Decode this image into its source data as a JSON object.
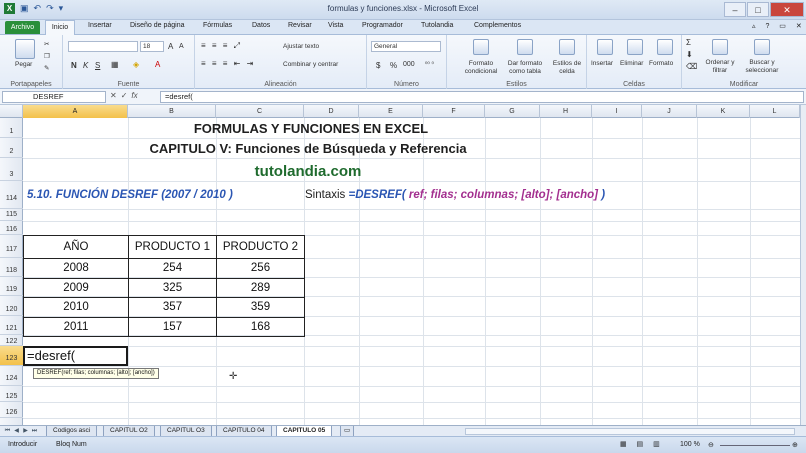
{
  "window": {
    "title": "formulas y funciones.xlsx - Microsoft Excel",
    "buttons": [
      "–",
      "□",
      "✕"
    ]
  },
  "ribbon_tabs": {
    "file": "Archivo",
    "active": "Inicio",
    "items": [
      "Insertar",
      "Diseño de página",
      "Fórmulas",
      "Datos",
      "Revisar",
      "Vista",
      "Programador",
      "Tutolandia",
      "Complementos"
    ]
  },
  "ribbon": {
    "groups": [
      "Portapapeles",
      "Fuente",
      "Alineación",
      "Número",
      "Estilos",
      "Celdas",
      "Modificar"
    ],
    "paste_label": "Pegar",
    "font_size": "18",
    "bold": "N",
    "italic": "K",
    "underline": "S",
    "wrap_text": "Ajustar texto",
    "merge_center": "Combinar y centrar",
    "number_format": "General",
    "currency": "$",
    "percent": "%",
    "thousands": "000",
    "styles_buttons": [
      "Formato condicional",
      "Dar formato como tabla",
      "Estilos de celda"
    ],
    "cells_buttons": [
      "Insertar",
      "Eliminar",
      "Formato"
    ],
    "edit_buttons": [
      "Ordenar y filtrar",
      "Buscar y seleccionar"
    ]
  },
  "formula_bar": {
    "name_box": "DESREF",
    "fx": "fx",
    "value": "=desref("
  },
  "columns": [
    "A",
    "B",
    "C",
    "D",
    "E",
    "F",
    "G",
    "H",
    "I",
    "J",
    "K",
    "L"
  ],
  "rows": [
    "1",
    "2",
    "3",
    "114",
    "115",
    "116",
    "117",
    "118",
    "119",
    "120",
    "121",
    "122",
    "123",
    "124",
    "125",
    "126"
  ],
  "sheet": {
    "title1": "FORMULAS Y FUNCIONES EN EXCEL",
    "title2": "CAPITULO V: Funciones de Búsqueda y Referencia",
    "site": "tutolandia.com",
    "section": "5.10. FUNCIÓN DESREF (2007 / 2010 )",
    "syntax_label": "Sintaxis",
    "syntax_fn": "=DESREF(",
    "syntax_args": "ref; filas; columnas; [alto]; [ancho]",
    "syntax_close": " )",
    "table": {
      "headers": [
        "AÑO",
        "PRODUCTO 1",
        "PRODUCTO 2"
      ],
      "rows": [
        [
          "2008",
          "254",
          "256"
        ],
        [
          "2009",
          "325",
          "289"
        ],
        [
          "2010",
          "357",
          "359"
        ],
        [
          "2011",
          "157",
          "168"
        ]
      ]
    },
    "active_cell_value": "=desref(",
    "tooltip": "DESREF(ref; filas; columnas; [alto]; [ancho])"
  },
  "sheet_tabs": [
    "Codigos asci",
    "CAPITUL O2",
    "CAPITUL O3",
    "CAPITULO 04",
    "CAPITULO 05"
  ],
  "status_bar": {
    "mode": "Introducir",
    "numlock": "Bloq Num",
    "zoom": "100 %"
  }
}
